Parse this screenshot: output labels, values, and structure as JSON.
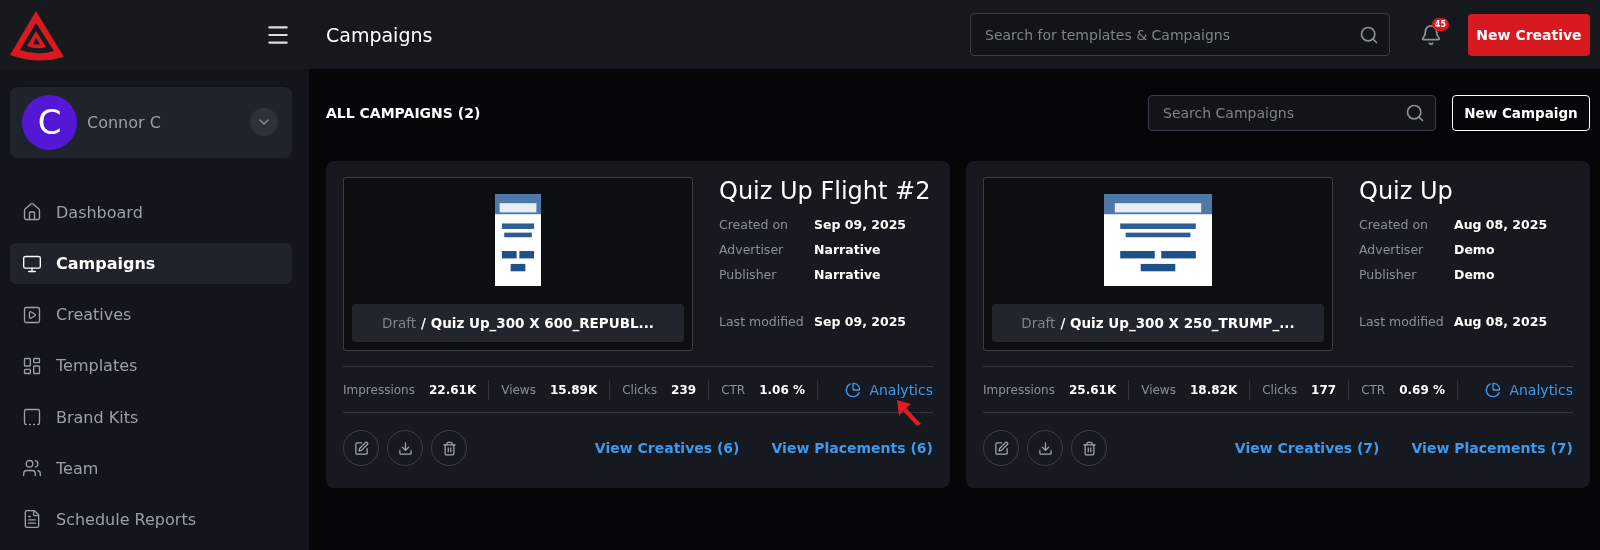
{
  "header": {
    "title": "Campaigns",
    "search": {
      "placeholder": "Search for templates & Campaigns"
    },
    "notifications": {
      "count": "45"
    },
    "primary_button": "New Creative"
  },
  "user": {
    "initial": "C",
    "name": "Connor C"
  },
  "nav": [
    {
      "label": "Dashboard",
      "selected": false
    },
    {
      "label": "Campaigns",
      "selected": true
    },
    {
      "label": "Creatives",
      "selected": false
    },
    {
      "label": "Templates",
      "selected": false
    },
    {
      "label": "Brand Kits",
      "selected": false
    },
    {
      "label": "Team",
      "selected": false
    },
    {
      "label": "Schedule Reports",
      "selected": false
    }
  ],
  "toolbar": {
    "heading": "ALL CAMPAIGNS (2)",
    "search": {
      "placeholder": "Search Campaigns"
    },
    "button": "New Campaign"
  },
  "campaigns": [
    {
      "title": "Quiz Up Flight #2",
      "status": "Draft",
      "creative": "/ Quiz Up_300 X 600_REPUBL...",
      "details": [
        {
          "label": "Created on",
          "value": "Sep 09, 2025"
        },
        {
          "label": "Advertiser",
          "value": "Narrative"
        },
        {
          "label": "Publisher",
          "value": "Narrative"
        },
        {
          "label": "Last modified",
          "value": "Sep 09, 2025"
        }
      ],
      "stats": [
        {
          "label": "Impressions",
          "value": "22.61K"
        },
        {
          "label": "Views",
          "value": "15.89K"
        },
        {
          "label": "Clicks",
          "value": "239"
        },
        {
          "label": "CTR",
          "value": "1.06 %"
        }
      ],
      "analytics": "Analytics",
      "annotated": true,
      "links": [
        "View Creatives (6)",
        "View Placements (6)"
      ]
    },
    {
      "title": "Quiz Up",
      "status": "Draft",
      "creative": "/ Quiz Up_300 X 250_TRUMP_...",
      "details": [
        {
          "label": "Created on",
          "value": "Aug 08, 2025"
        },
        {
          "label": "Advertiser",
          "value": "Demo"
        },
        {
          "label": "Publisher",
          "value": "Demo"
        },
        {
          "label": "Last modified",
          "value": "Aug 08, 2025"
        }
      ],
      "stats": [
        {
          "label": "Impressions",
          "value": "25.61K"
        },
        {
          "label": "Views",
          "value": "18.82K"
        },
        {
          "label": "Clicks",
          "value": "177"
        },
        {
          "label": "CTR",
          "value": "0.69 %"
        }
      ],
      "analytics": "Analytics",
      "annotated": false,
      "links": [
        "View Creatives (7)",
        "View Placements (7)"
      ]
    }
  ]
}
